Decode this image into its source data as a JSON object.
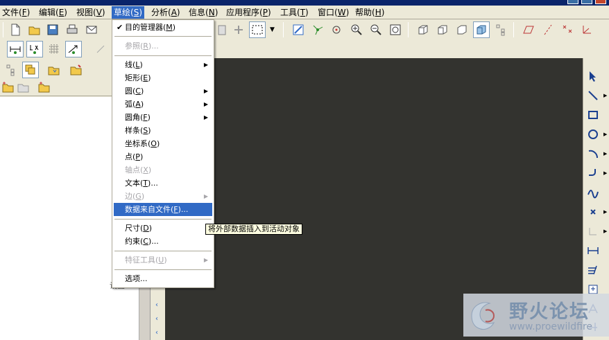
{
  "menubar": {
    "items": [
      {
        "label": "文件",
        "key": "F"
      },
      {
        "label": "编辑",
        "key": "E"
      },
      {
        "label": "视图",
        "key": "V"
      },
      {
        "label": "草绘",
        "key": "S"
      },
      {
        "label": "分析",
        "key": "A"
      },
      {
        "label": "信息",
        "key": "N"
      },
      {
        "label": "应用程序",
        "key": "P"
      },
      {
        "label": "工具",
        "key": "T"
      },
      {
        "label": "窗口",
        "key": "W"
      },
      {
        "label": "帮助",
        "key": "H"
      }
    ]
  },
  "sketch_menu": {
    "items": [
      {
        "label": "目的管理器",
        "key": "M",
        "suffix": "",
        "checked": true
      },
      {
        "label": "参照",
        "key": "R",
        "suffix": "...",
        "disabled": true
      },
      {
        "label": "线",
        "key": "L",
        "suffix": "",
        "submenu": true
      },
      {
        "label": "矩形",
        "key": "E",
        "suffix": ""
      },
      {
        "label": "圆",
        "key": "C",
        "suffix": "",
        "submenu": true
      },
      {
        "label": "弧",
        "key": "A",
        "suffix": "",
        "submenu": true
      },
      {
        "label": "圆角",
        "key": "F",
        "suffix": "",
        "submenu": true
      },
      {
        "label": "样条",
        "key": "S",
        "suffix": ""
      },
      {
        "label": "坐标系",
        "key": "O",
        "suffix": ""
      },
      {
        "label": "点",
        "key": "P",
        "suffix": ""
      },
      {
        "label": "轴点",
        "key": "X",
        "suffix": "",
        "disabled": true
      },
      {
        "label": "文本",
        "key": "T",
        "suffix": "..."
      },
      {
        "label": "边",
        "key": "G",
        "suffix": "",
        "disabled": true,
        "submenu": true
      },
      {
        "label": "数据来自文件",
        "key": "F",
        "suffix": "...",
        "highlighted": true
      },
      {
        "label": "尺寸",
        "key": "D",
        "suffix": ""
      },
      {
        "label": "约束",
        "key": "C",
        "suffix": "..."
      },
      {
        "label": "特征工具",
        "key": "U",
        "suffix": "",
        "disabled": true,
        "submenu": true
      },
      {
        "label": "选项",
        "key": "",
        "suffix": "..."
      }
    ]
  },
  "tooltip": "将外部数据插入到活动对象",
  "left_panel": {
    "partial_label": "设置"
  },
  "watermark": {
    "title": "野火论坛",
    "url": "www.proewildfire"
  },
  "colors": {
    "menu_highlight": "#316AC5",
    "graphics_bg": "#33332F",
    "chrome": "#ECE9D8"
  },
  "icons": {
    "top_toolbar": [
      "new-icon",
      "open-icon",
      "save-icon",
      "print-icon",
      "email-icon",
      "paste-icon",
      "regenerate-icon",
      "select-box-icon",
      "repaint-icon",
      "spin-center-icon",
      "orient-icon",
      "zoom-in-icon",
      "zoom-out-icon",
      "refit-icon",
      "view-iso-icon",
      "view-front-icon",
      "view-top-icon",
      "shaded-icon",
      "model-tree-icon",
      "datum-plane-icon",
      "datum-axis-icon",
      "datum-point-icon",
      "datum-csys-icon"
    ],
    "right_toolbar": [
      "select-arrow-icon",
      "line-icon",
      "rectangle-icon",
      "circle-icon",
      "arc-icon",
      "fillet-icon",
      "spline-icon",
      "point-icon",
      "centerline-icon",
      "dimension-icon",
      "modify-icon",
      "constraint-icon",
      "text-icon",
      "trim-icon"
    ]
  }
}
